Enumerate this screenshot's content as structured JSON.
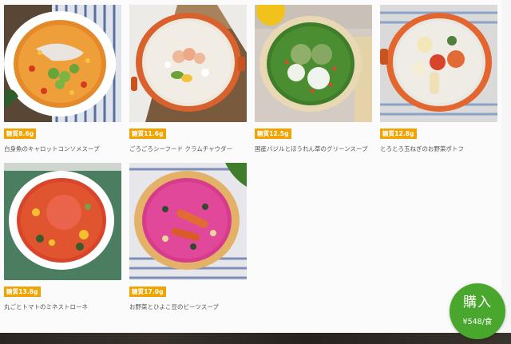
{
  "products": [
    {
      "tag": "糖質8.6g",
      "name": "白身魚のキャロットコンソメスープ"
    },
    {
      "tag": "糖質11.6g",
      "name": "ごろごろシーフード クラムチャウダー"
    },
    {
      "tag": "糖質12.5g",
      "name": "国産バジルとほうれん草のグリーンスープ"
    },
    {
      "tag": "糖質12.8g",
      "name": "とろとろ玉ねぎのお野菜ポトフ"
    },
    {
      "tag": "糖質13.8g",
      "name": "丸ごとトマトのミネストローネ"
    },
    {
      "tag": "糖質17.0g",
      "name": "お野菜とひよこ豆のビーツスープ"
    }
  ],
  "buy": {
    "label": "購入",
    "price": "¥548/食"
  },
  "colors": {
    "tag": "#f1a300",
    "buy": "#4aa72e"
  }
}
